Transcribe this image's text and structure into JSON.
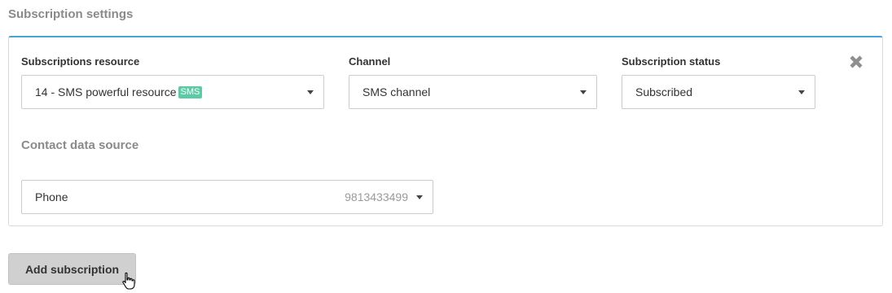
{
  "section": {
    "title": "Subscription settings"
  },
  "subscription": {
    "resource": {
      "label": "Subscriptions resource",
      "value": "14 - SMS powerful resource",
      "badge": "SMS"
    },
    "channel": {
      "label": "Channel",
      "value": "SMS channel"
    },
    "status": {
      "label": "Subscription status",
      "value": "Subscribed"
    },
    "contact_source": {
      "label": "Contact data source",
      "value": "Phone",
      "secondary": "9813433499"
    }
  },
  "actions": {
    "add_subscription": "Add subscription"
  },
  "icons": {
    "close": "close-icon",
    "caret": "chevron-down-icon",
    "cursor": "hand-pointer-icon"
  },
  "colors": {
    "accent_border": "#4aa3d8",
    "badge_bg": "#5cc9a7",
    "button_bg": "#d0d0d0",
    "muted_heading": "#8a8a8a"
  }
}
